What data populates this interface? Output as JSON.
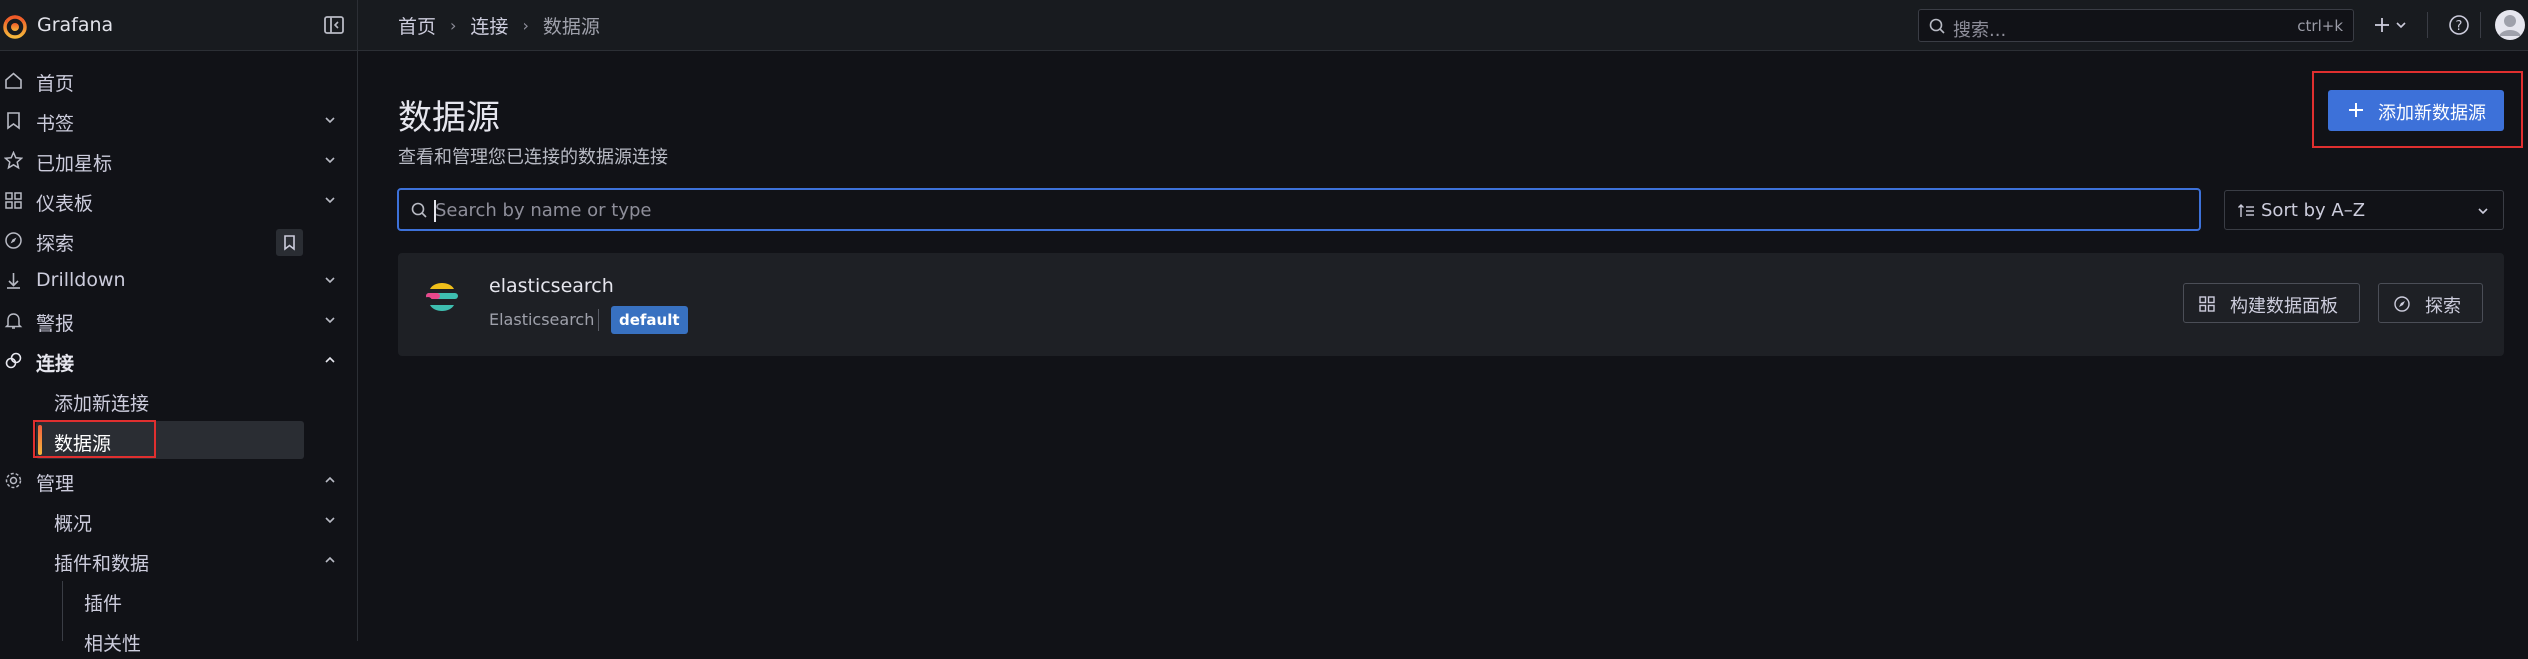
{
  "app": {
    "name": "Grafana"
  },
  "breadcrumb": {
    "home": "首页",
    "connections": "连接",
    "current": "数据源"
  },
  "top_search": {
    "placeholder": "搜索...",
    "shortcut": "ctrl+k"
  },
  "sidebar": {
    "items": [
      {
        "label": "首页",
        "icon": "home-icon"
      },
      {
        "label": "书签",
        "icon": "bookmark-icon"
      },
      {
        "label": "已加星标",
        "icon": "star-icon"
      },
      {
        "label": "仪表板",
        "icon": "apps-icon"
      },
      {
        "label": "探索",
        "icon": "compass-icon"
      },
      {
        "label": "Drilldown",
        "icon": "drilldown-icon"
      },
      {
        "label": "警报",
        "icon": "bell-icon"
      },
      {
        "label": "连接",
        "icon": "link-icon"
      },
      {
        "label": "添加新连接"
      },
      {
        "label": "数据源"
      },
      {
        "label": "管理",
        "icon": "cog-icon"
      },
      {
        "label": "概况"
      },
      {
        "label": "插件和数据"
      },
      {
        "label": "插件"
      },
      {
        "label": "相关性"
      }
    ]
  },
  "page": {
    "title": "数据源",
    "subtitle": "查看和管理您已连接的数据源连接",
    "add_button": "添加新数据源"
  },
  "search": {
    "placeholder": "Search by name or type"
  },
  "sort": {
    "selected": "Sort by A–Z"
  },
  "datasources": [
    {
      "name": "elasticsearch",
      "type": "Elasticsearch",
      "badge": "default",
      "actions": [
        "构建数据面板",
        "探索"
      ]
    }
  ],
  "colors": {
    "accent": "#3d71d9",
    "badge": "#3871c1",
    "highlight": "#e02f2f",
    "background": "#111217"
  }
}
